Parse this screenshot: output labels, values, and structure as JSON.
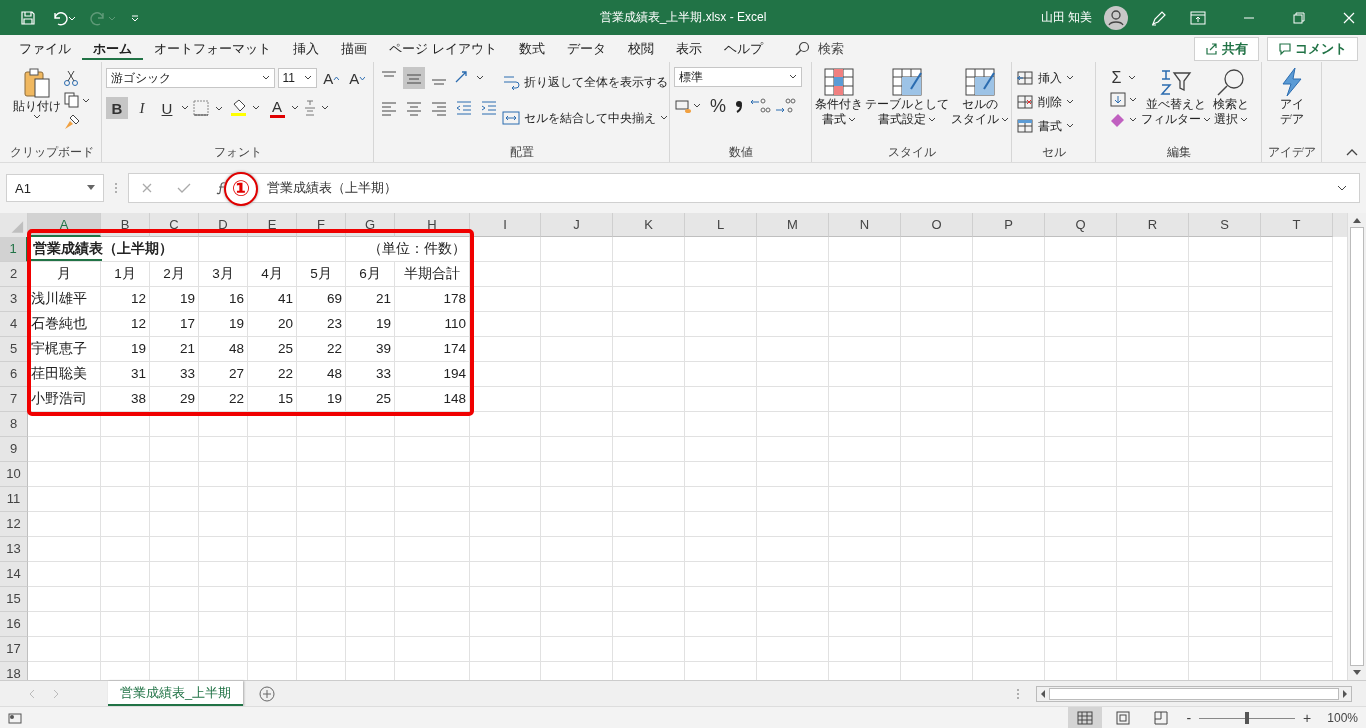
{
  "window": {
    "title": "営業成績表_上半期.xlsx  -  Excel",
    "user": "山田 知美"
  },
  "ribbon_tabs": [
    {
      "label": "ファイル",
      "selected": false
    },
    {
      "label": "ホーム",
      "selected": true
    },
    {
      "label": "オートフォーマット",
      "selected": false
    },
    {
      "label": "挿入",
      "selected": false
    },
    {
      "label": "描画",
      "selected": false
    },
    {
      "label": "ページ レイアウト",
      "selected": false
    },
    {
      "label": "数式",
      "selected": false
    },
    {
      "label": "データ",
      "selected": false
    },
    {
      "label": "校閲",
      "selected": false
    },
    {
      "label": "表示",
      "selected": false
    },
    {
      "label": "ヘルプ",
      "selected": false
    }
  ],
  "search": {
    "placeholder": "検索"
  },
  "share_button": "共有",
  "comment_button": "コメント",
  "clipboard": {
    "label": "クリップボード",
    "paste": "貼り付け"
  },
  "font": {
    "label": "フォント",
    "font_name": "游ゴシック",
    "font_size": "11",
    "grow": "A",
    "shrink": "A",
    "color_letter": "A",
    "styles": [
      {
        "label": "B",
        "selected": true
      },
      {
        "label": "I",
        "selected": false
      },
      {
        "label": "U",
        "selected": false
      }
    ]
  },
  "alignment": {
    "label": "配置",
    "wrap_text": "折り返して全体を表示する",
    "merge_center": "セルを結合して中央揃え",
    "vertical": [
      {
        "selected": false
      },
      {
        "selected": true
      },
      {
        "selected": false
      }
    ]
  },
  "number": {
    "label": "数値",
    "format": "標準",
    "percent": "%"
  },
  "styles": {
    "label": "スタイル",
    "buttons": [
      {
        "lines": [
          "条件付き",
          "書式"
        ]
      },
      {
        "lines": [
          "テーブルとして",
          "書式設定"
        ]
      },
      {
        "lines": [
          "セルの",
          "スタイル"
        ]
      }
    ]
  },
  "cells": {
    "label": "セル",
    "buttons": [
      "挿入",
      "削除",
      "書式"
    ]
  },
  "editing": {
    "label": "編集",
    "sum": "Σ",
    "buttons": [
      {
        "lines": [
          "並べ替えと",
          "フィルター"
        ]
      },
      {
        "lines": [
          "検索と",
          "選択"
        ]
      }
    ]
  },
  "ideas": {
    "label": "アイデア",
    "lines": [
      "アイ",
      "デア"
    ]
  },
  "formula_bar": {
    "name_box": "A1",
    "formula": "営業成績表（上半期）"
  },
  "annotation": {
    "marker": "①"
  },
  "sheet": {
    "title": "営業成績表（上半期）",
    "unit": "（単位：件数）",
    "columns": [
      {
        "label": "A",
        "selected": true
      },
      {
        "label": "B",
        "selected": false
      },
      {
        "label": "C",
        "selected": false
      },
      {
        "label": "D",
        "selected": false
      },
      {
        "label": "E",
        "selected": false
      },
      {
        "label": "F",
        "selected": false
      },
      {
        "label": "G",
        "selected": false
      },
      {
        "label": "H",
        "selected": false
      },
      {
        "label": "I",
        "selected": false
      },
      {
        "label": "J",
        "selected": false
      },
      {
        "label": "K",
        "selected": false
      },
      {
        "label": "L",
        "selected": false
      },
      {
        "label": "M",
        "selected": false
      },
      {
        "label": "N",
        "selected": false
      },
      {
        "label": "O",
        "selected": false
      },
      {
        "label": "P",
        "selected": false
      },
      {
        "label": "Q",
        "selected": false
      },
      {
        "label": "R",
        "selected": false
      },
      {
        "label": "S",
        "selected": false
      },
      {
        "label": "T",
        "selected": false
      }
    ],
    "row_headers": [
      {
        "label": "1",
        "selected": true
      },
      {
        "label": "2",
        "selected": false
      },
      {
        "label": "3",
        "selected": false
      },
      {
        "label": "4",
        "selected": false
      },
      {
        "label": "5",
        "selected": false
      },
      {
        "label": "6",
        "selected": false
      },
      {
        "label": "7",
        "selected": false
      },
      {
        "label": "8",
        "selected": false
      },
      {
        "label": "9",
        "selected": false
      },
      {
        "label": "10",
        "selected": false
      },
      {
        "label": "11",
        "selected": false
      },
      {
        "label": "12",
        "selected": false
      },
      {
        "label": "13",
        "selected": false
      },
      {
        "label": "14",
        "selected": false
      },
      {
        "label": "15",
        "selected": false
      },
      {
        "label": "16",
        "selected": false
      },
      {
        "label": "17",
        "selected": false
      },
      {
        "label": "18",
        "selected": false
      }
    ],
    "header_row": [
      "月",
      "1月",
      "2月",
      "3月",
      "4月",
      "5月",
      "6月",
      "半期合計"
    ],
    "rows": [
      {
        "name": "浅川雄平",
        "values": [
          "12",
          "19",
          "16",
          "41",
          "69",
          "21",
          "178"
        ]
      },
      {
        "name": "石巻純也",
        "values": [
          "12",
          "17",
          "19",
          "20",
          "23",
          "19",
          "110"
        ]
      },
      {
        "name": "宇梶恵子",
        "values": [
          "19",
          "21",
          "48",
          "25",
          "22",
          "39",
          "174"
        ]
      },
      {
        "name": "荏田聡美",
        "values": [
          "31",
          "33",
          "27",
          "22",
          "48",
          "33",
          "194"
        ]
      },
      {
        "name": "小野浩司",
        "values": [
          "38",
          "29",
          "22",
          "15",
          "19",
          "25",
          "148"
        ]
      }
    ]
  },
  "sheet_tabs": [
    {
      "label": "営業成績表_上半期",
      "selected": true
    }
  ],
  "status_bar": {
    "views": [
      {
        "kind": "normal",
        "selected": true
      },
      {
        "kind": "page_layout",
        "selected": false
      },
      {
        "kind": "page_break",
        "selected": false
      }
    ],
    "zoom_minus": "-",
    "zoom_plus": "+",
    "zoom_slider": {
      "level": 0.5
    },
    "zoom": "100%"
  }
}
